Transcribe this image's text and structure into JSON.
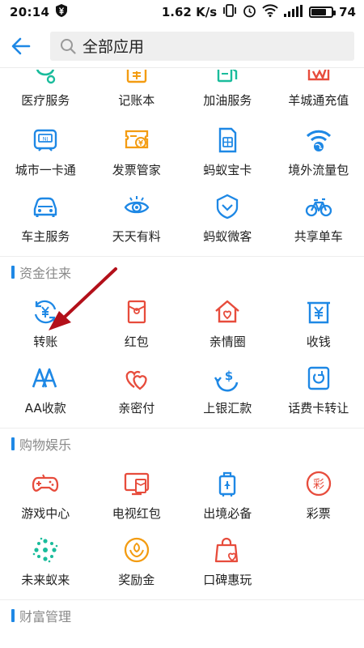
{
  "status_bar": {
    "time": "20:14",
    "speed": "1.62 K/s",
    "battery": "74"
  },
  "header": {
    "search_text": "全部应用"
  },
  "colors": {
    "accent": "#1e88e5",
    "orange": "#f39c12",
    "red": "#e74c3c",
    "teal": "#1abc9c",
    "annotation": "#b3101a"
  },
  "top_rows": [
    [
      {
        "label": "医疗服务",
        "icon": "stethoscope-icon"
      },
      {
        "label": "记账本",
        "icon": "ledger-icon"
      },
      {
        "label": "加油服务",
        "icon": "fuel-pump-icon"
      },
      {
        "label": "羊城通充值",
        "icon": "transit-card-icon"
      }
    ],
    [
      {
        "label": "城市一卡通",
        "icon": "city-card-icon"
      },
      {
        "label": "发票管家",
        "icon": "invoice-icon"
      },
      {
        "label": "蚂蚁宝卡",
        "icon": "sim-card-icon"
      },
      {
        "label": "境外流量包",
        "icon": "wifi-globe-icon"
      }
    ],
    [
      {
        "label": "车主服务",
        "icon": "car-icon"
      },
      {
        "label": "天天有料",
        "icon": "eye-icon"
      },
      {
        "label": "蚂蚁微客",
        "icon": "shield-icon"
      },
      {
        "label": "共享单车",
        "icon": "bicycle-icon"
      }
    ]
  ],
  "sections": [
    {
      "title": "资金往来",
      "rows": [
        [
          {
            "label": "转账",
            "icon": "transfer-icon"
          },
          {
            "label": "红包",
            "icon": "red-envelope-icon"
          },
          {
            "label": "亲情圈",
            "icon": "family-house-icon"
          },
          {
            "label": "收钱",
            "icon": "receive-money-icon"
          }
        ],
        [
          {
            "label": "AA收款",
            "icon": "aa-collect-icon"
          },
          {
            "label": "亲密付",
            "icon": "hearts-icon"
          },
          {
            "label": "上银汇款",
            "icon": "remittance-icon"
          },
          {
            "label": "话费卡转让",
            "icon": "phone-card-transfer-icon"
          }
        ]
      ]
    },
    {
      "title": "购物娱乐",
      "rows": [
        [
          {
            "label": "游戏中心",
            "icon": "gamepad-icon"
          },
          {
            "label": "电视红包",
            "icon": "tv-envelope-icon"
          },
          {
            "label": "出境必备",
            "icon": "luggage-icon"
          },
          {
            "label": "彩票",
            "icon": "lottery-icon"
          }
        ],
        [
          {
            "label": "未来蚁来",
            "icon": "sparkle-icon"
          },
          {
            "label": "奖励金",
            "icon": "reward-icon"
          },
          {
            "label": "口碑惠玩",
            "icon": "shopping-bag-icon"
          }
        ]
      ]
    },
    {
      "title": "财富管理",
      "rows": []
    }
  ]
}
